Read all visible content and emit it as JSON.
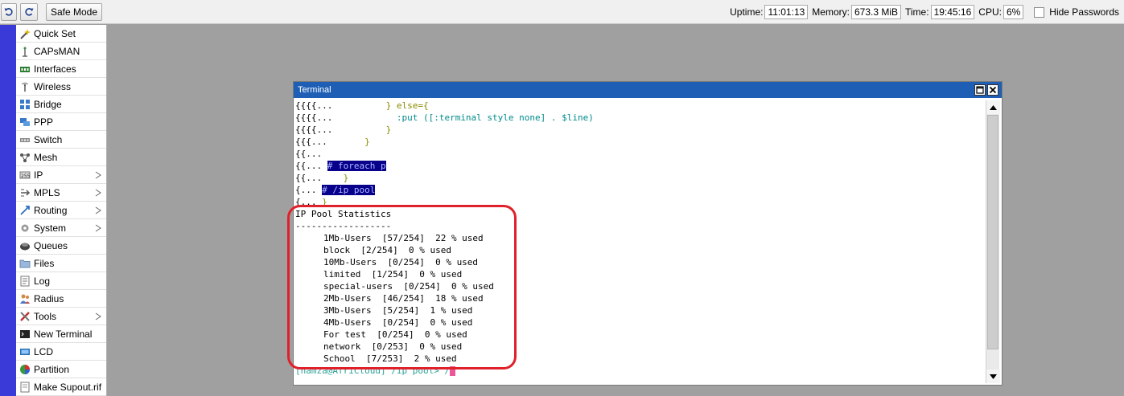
{
  "toolbar": {
    "undo_icon": "undo-icon",
    "redo_icon": "redo-icon",
    "safe_mode": "Safe Mode",
    "uptime_label": "Uptime:",
    "uptime": "11:01:13",
    "memory_label": "Memory:",
    "memory": "673.3 MiB",
    "time_label": "Time:",
    "time": "19:45:16",
    "cpu_label": "CPU:",
    "cpu": "6%",
    "hide_passwords": "Hide Passwords",
    "hide_passwords_checked": false
  },
  "sidebar": {
    "items": [
      {
        "label": "Quick Set",
        "icon": "wand-icon",
        "submenu": false
      },
      {
        "label": "CAPsMAN",
        "icon": "antenna-icon",
        "submenu": false
      },
      {
        "label": "Interfaces",
        "icon": "interfaces-icon",
        "submenu": false
      },
      {
        "label": "Wireless",
        "icon": "wireless-icon",
        "submenu": false
      },
      {
        "label": "Bridge",
        "icon": "bridge-icon",
        "submenu": false
      },
      {
        "label": "PPP",
        "icon": "ppp-icon",
        "submenu": false
      },
      {
        "label": "Switch",
        "icon": "switch-icon",
        "submenu": false
      },
      {
        "label": "Mesh",
        "icon": "mesh-icon",
        "submenu": false
      },
      {
        "label": "IP",
        "icon": "ip-icon",
        "submenu": true
      },
      {
        "label": "MPLS",
        "icon": "mpls-icon",
        "submenu": true
      },
      {
        "label": "Routing",
        "icon": "routing-icon",
        "submenu": true
      },
      {
        "label": "System",
        "icon": "gear-icon",
        "submenu": true
      },
      {
        "label": "Queues",
        "icon": "queues-icon",
        "submenu": false
      },
      {
        "label": "Files",
        "icon": "folder-icon",
        "submenu": false
      },
      {
        "label": "Log",
        "icon": "log-icon",
        "submenu": false
      },
      {
        "label": "Radius",
        "icon": "users-icon",
        "submenu": false
      },
      {
        "label": "Tools",
        "icon": "tools-icon",
        "submenu": true
      },
      {
        "label": "New Terminal",
        "icon": "terminal-icon",
        "submenu": false
      },
      {
        "label": "LCD",
        "icon": "lcd-icon",
        "submenu": false
      },
      {
        "label": "Partition",
        "icon": "pie-icon",
        "submenu": false
      },
      {
        "label": "Make Supout.rif",
        "icon": "document-icon",
        "submenu": false
      }
    ]
  },
  "terminal": {
    "title": "Terminal",
    "script_lines": [
      {
        "prefix": "{{{{...          ",
        "code": "} else={"
      },
      {
        "prefix": "{{{{...            ",
        "code": ":put ([:terminal style none] . $line)"
      },
      {
        "prefix": "{{{{...          ",
        "code": "}"
      },
      {
        "prefix": "{{{...       ",
        "code": "}"
      },
      {
        "prefix": "{{...",
        "code": ""
      },
      {
        "prefix": "{{... ",
        "code": "# foreach p"
      },
      {
        "prefix": "{{...    ",
        "code": "}"
      },
      {
        "prefix": "{... ",
        "code": "# /ip pool"
      },
      {
        "prefix": "{... ",
        "code": "}"
      }
    ],
    "stats_title": "IP Pool Statistics",
    "separator": "------------------",
    "pools": [
      "1Mb-Users  [57/254]  22 % used",
      "block  [2/254]  0 % used",
      "10Mb-Users  [0/254]  0 % used",
      "limited  [1/254]  0 % used",
      "special-users  [0/254]  0 % used",
      "2Mb-Users  [46/254]  18 % used",
      "3Mb-Users  [5/254]  1 % used",
      "4Mb-Users  [0/254]  0 % used",
      "For test  [0/254]  0 % used",
      "network  [0/253]  0 % used",
      "School  [7/253]  2 % used"
    ],
    "prompt_user": "[hamza@AfriCloud]",
    "prompt_path": " /ip pool> /"
  }
}
